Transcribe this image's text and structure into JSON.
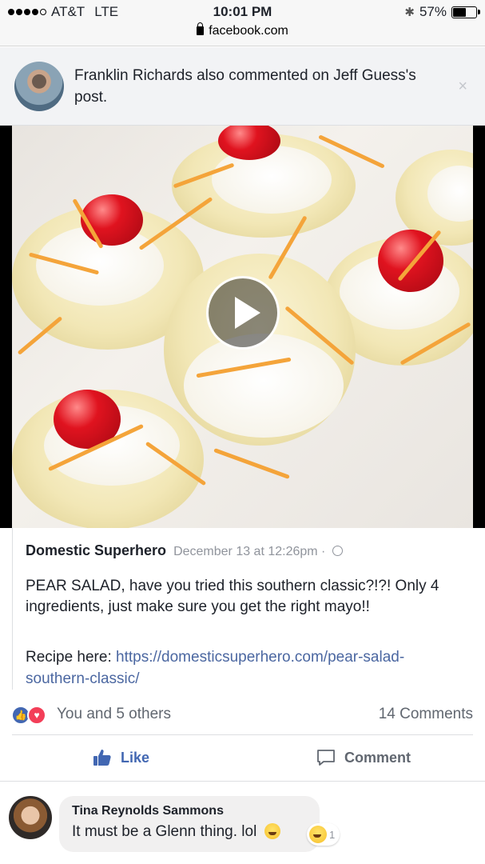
{
  "status_bar": {
    "carrier": "AT&T",
    "network": "LTE",
    "time": "10:01 PM",
    "url": "facebook.com",
    "battery": "57%",
    "battery_level": 0.57
  },
  "notification": {
    "text": "Franklin Richards also commented on Jeff Guess's post.",
    "close_symbol": "×"
  },
  "post": {
    "page_name": "Domestic Superhero",
    "timestamp": "December 13 at 12:26pm ·",
    "text": "PEAR SALAD, have you tried this southern classic?!?! Only 4 ingredients, just make sure you get the right mayo!!",
    "recipe_label": "Recipe here: ",
    "recipe_link": "https://domesticsuperhero.com/pear-salad-southern-classic/"
  },
  "reactions": {
    "summary": "You and 5 others",
    "comments": "14 Comments"
  },
  "actions": {
    "like": "Like",
    "comment": "Comment"
  },
  "comment": {
    "author": "Tina Reynolds Sammons",
    "text": "It must be a Glenn thing. lol",
    "reaction_count": "1"
  },
  "colors": {
    "facebook_blue": "#4267b2",
    "link": "#4b67a1",
    "love_red": "#f33e58"
  }
}
